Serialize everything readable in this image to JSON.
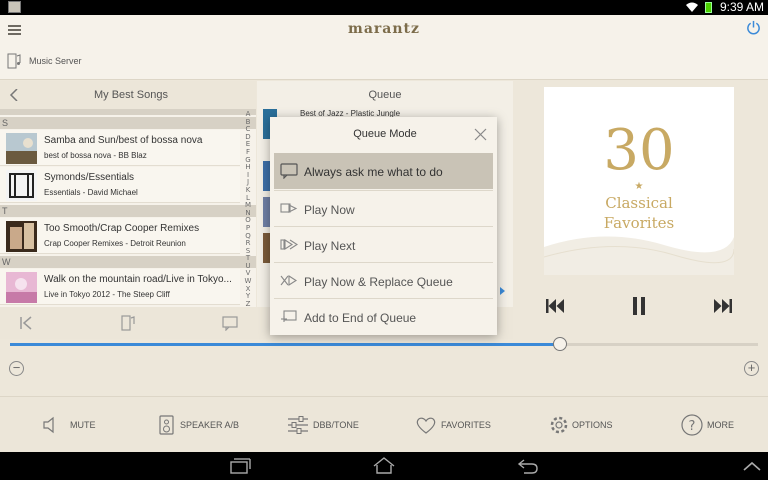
{
  "status_bar": {
    "time": "9:39 AM"
  },
  "header": {
    "brand": "marantz"
  },
  "source": {
    "label": "Music Server"
  },
  "left_panel": {
    "title": "My Best Songs",
    "sections": [
      {
        "letter": "S",
        "songs": [
          {
            "title": "Samba and Sun/best of bossa nova",
            "subtitle": "best of bossa nova - BB Blaz"
          },
          {
            "title": "Symonds/Essentials",
            "subtitle": "Essentials - David Michael"
          }
        ]
      },
      {
        "letter": "T",
        "songs": [
          {
            "title": "Too Smooth/Crap Cooper Remixes",
            "subtitle": "Crap Cooper Remixes - Detroit Reunion"
          }
        ]
      },
      {
        "letter": "W",
        "songs": [
          {
            "title": "Walk on the mountain road/Live in Tokyo...",
            "subtitle": "Live in Tokyo 2012 - The Steep Cliff"
          }
        ]
      }
    ],
    "alphabet": [
      "A",
      "B",
      "C",
      "D",
      "E",
      "F",
      "G",
      "H",
      "I",
      "J",
      "K",
      "L",
      "M",
      "N",
      "O",
      "P",
      "Q",
      "R",
      "S",
      "T",
      "U",
      "V",
      "W",
      "X",
      "Y",
      "Z",
      "#"
    ]
  },
  "queue_panel": {
    "title": "Queue",
    "first_item": "Best of Jazz - Plastic Jungle"
  },
  "album_art": {
    "number": "30",
    "star": "★",
    "line1": "Classical",
    "line2": "Favorites"
  },
  "playback": {
    "progress_fraction": 0.735
  },
  "bottom_bar": [
    {
      "label": "MUTE",
      "icon": "speaker-icon"
    },
    {
      "label": "SPEAKER A/B",
      "icon": "speaker-ab-icon"
    },
    {
      "label": "DBB/TONE",
      "icon": "tone-sliders-icon"
    },
    {
      "label": "FAVORITES",
      "icon": "heart-icon"
    },
    {
      "label": "OPTIONS",
      "icon": "gear-icon"
    },
    {
      "label": "MORE",
      "icon": "question-icon"
    }
  ],
  "modal": {
    "title": "Queue Mode",
    "options": [
      {
        "label": "Always ask me what to do",
        "selected": true,
        "icon": "speech-bubble-icon"
      },
      {
        "label": "Play Now",
        "selected": false,
        "icon": "play-now-icon"
      },
      {
        "label": "Play Next",
        "selected": false,
        "icon": "play-next-icon"
      },
      {
        "label": "Play Now & Replace Queue",
        "selected": false,
        "icon": "replace-queue-icon"
      },
      {
        "label": "Add to End of Queue",
        "selected": false,
        "icon": "add-to-end-icon"
      }
    ]
  },
  "colors": {
    "accent": "#3b8ad8",
    "gold": "#c8a963",
    "background": "#ede7da"
  }
}
